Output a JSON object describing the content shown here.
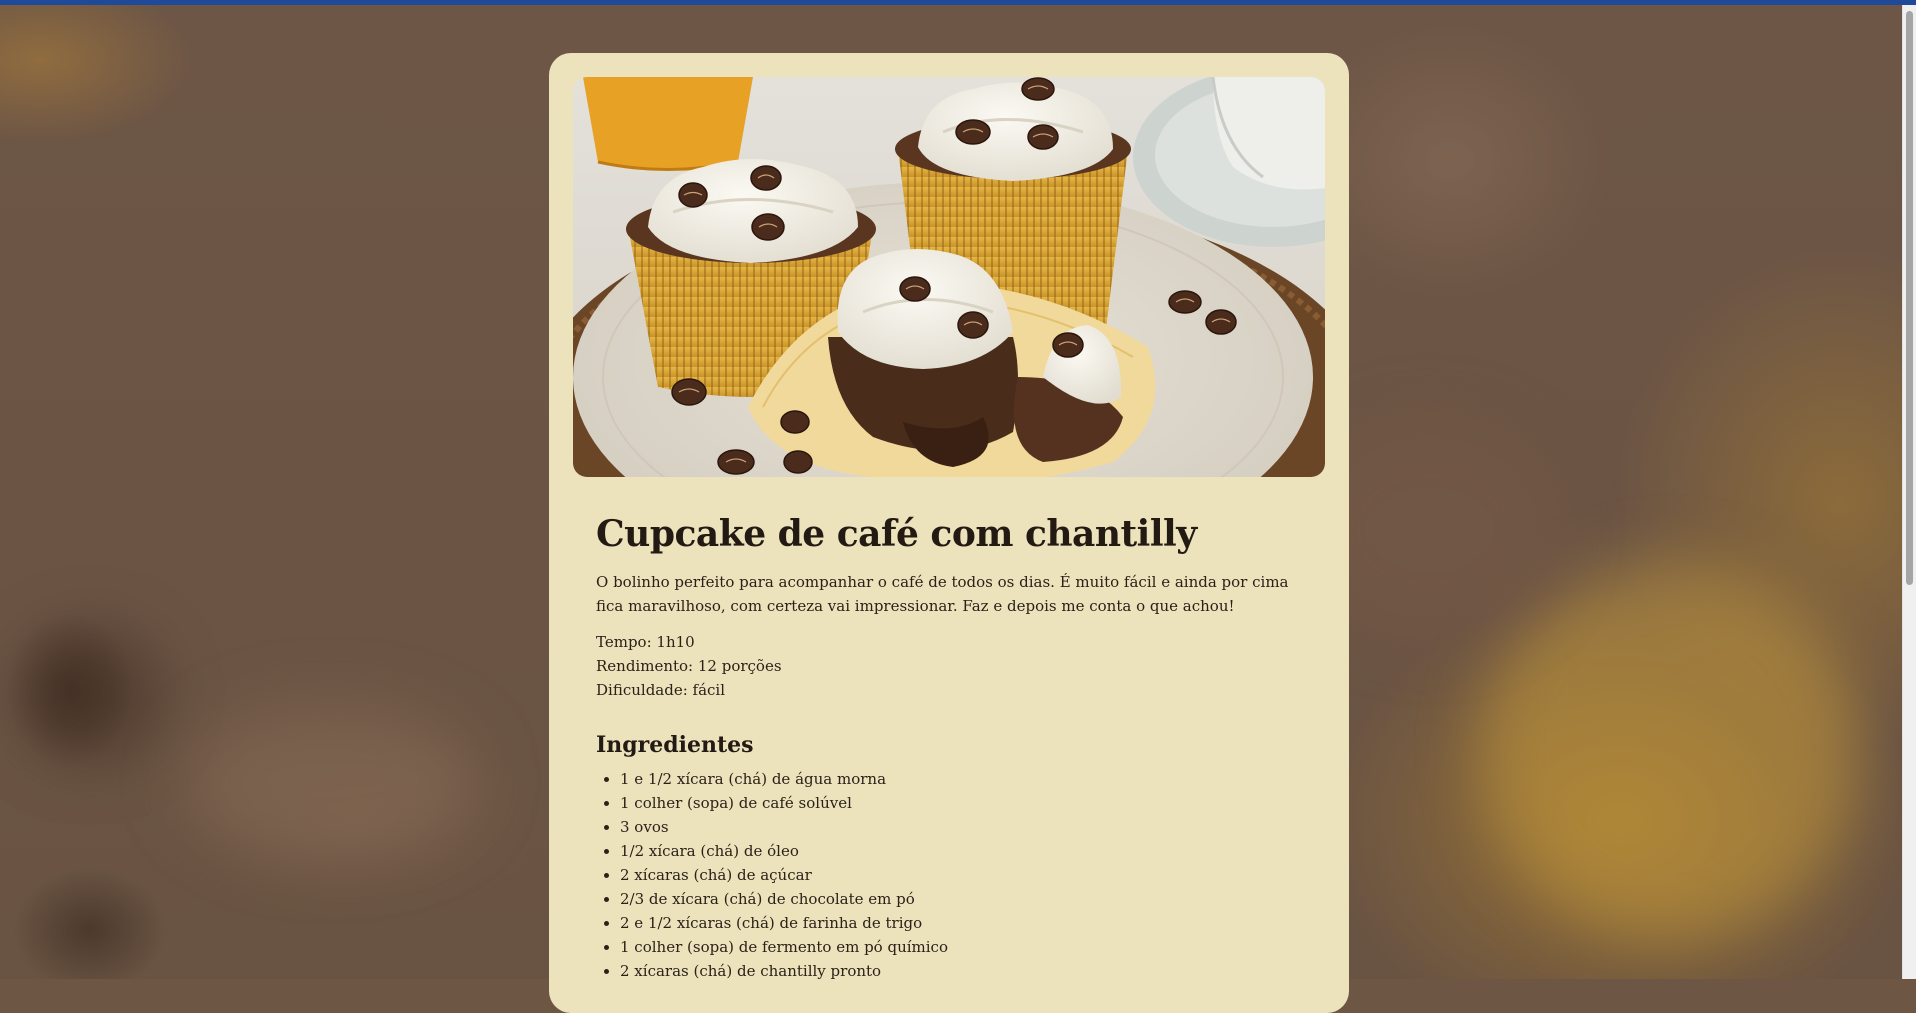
{
  "recipe": {
    "title": "Cupcake de café com chantilly",
    "description": "O bolinho perfeito para acompanhar o café de todos os dias. É muito fácil e ainda por cima fica maravilhoso, com certeza vai impressionar. Faz e depois me conta o que achou!",
    "time": "Tempo: 1h10",
    "yield": "Rendimento: 12 porções",
    "difficulty": "Dificuldade: fácil",
    "ingredients_title": "Ingredientes",
    "ingredients": [
      "1 e 1/2 xícara (chá) de água morna",
      "1 colher (sopa) de café solúvel",
      "3 ovos",
      "1/2 xícara (chá) de óleo",
      "2 xícaras (chá) de açúcar",
      "2/3 de xícara (chá) de chocolate em pó",
      "2 e 1/2 xícaras (chá) de farinha de trigo",
      "1 colher (sopa) de fermento em pó químico",
      "2 xícaras (chá) de chantilly pronto"
    ]
  },
  "colors": {
    "card": "#ece3bc",
    "text": "#2b2119",
    "background": "#6e5645",
    "topbar": "#1f4a9a"
  }
}
